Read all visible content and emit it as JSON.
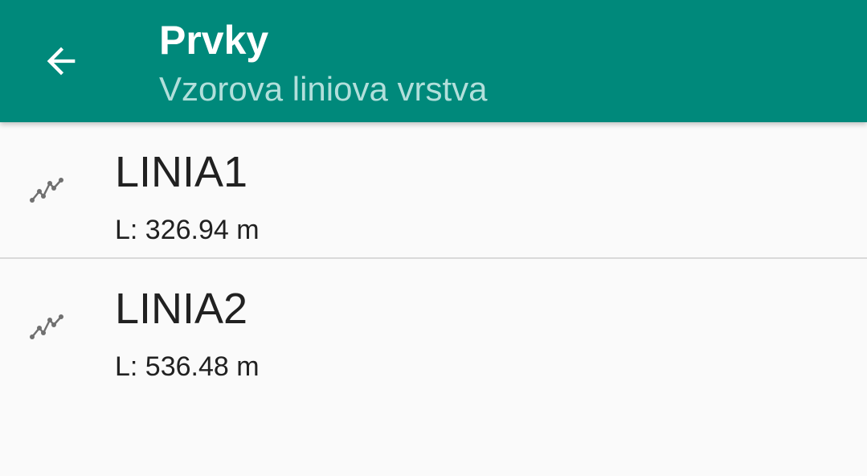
{
  "appbar": {
    "title": "Prvky",
    "subtitle": "Vzorova liniova vrstva",
    "back_icon": "arrow-back-icon",
    "background_color": "#00897b"
  },
  "features": [
    {
      "name": "LINIA1",
      "length_label": "L: 326.94 m",
      "icon": "polyline-icon"
    },
    {
      "name": "LINIA2",
      "length_label": "L: 536.48 m",
      "icon": "polyline-icon"
    }
  ]
}
